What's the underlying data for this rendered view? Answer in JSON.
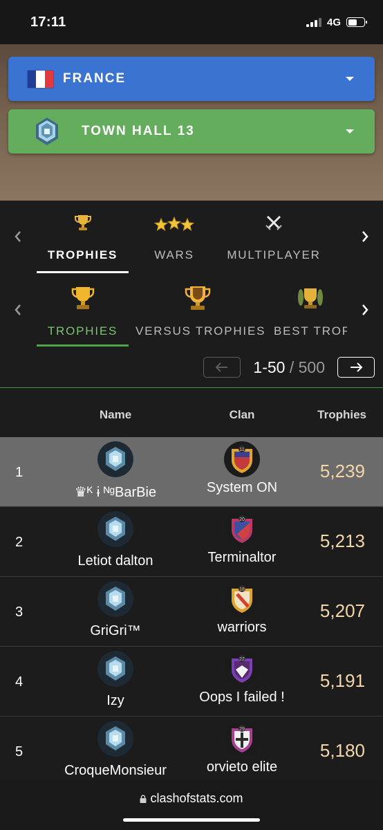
{
  "status_bar": {
    "time": "17:11",
    "network": "4G"
  },
  "filters": {
    "country": {
      "label": "FRANCE"
    },
    "town_hall": {
      "label": "TOWN HALL 13"
    }
  },
  "main_tabs": [
    {
      "label": "TROPHIES",
      "icon": "trophy-icon",
      "active": true
    },
    {
      "label": "WARS",
      "icon": "stars-icon",
      "active": false
    },
    {
      "label": "MULTIPLAYER",
      "icon": "crossed-swords-icon",
      "active": false
    }
  ],
  "sub_tabs": [
    {
      "label": "TROPHIES",
      "icon": "gold-trophy-icon",
      "active": true
    },
    {
      "label": "VERSUS TROPHIES",
      "icon": "versus-trophy-icon",
      "active": false
    },
    {
      "label": "BEST TROP",
      "icon": "laurel-trophy-icon",
      "active": false
    }
  ],
  "pager": {
    "range": "1-50",
    "separator": " / ",
    "total": "500"
  },
  "table": {
    "headers": {
      "name": "Name",
      "clan": "Clan",
      "trophies": "Trophies"
    },
    "rows": [
      {
        "rank": "1",
        "name": "♛ᴷ ɨ ᴺᵍBarBie",
        "clan": "System ON",
        "clan_level": "11",
        "trophies": "5,239"
      },
      {
        "rank": "2",
        "name": "Letiot dalton",
        "clan": "Terminaltor",
        "clan_level": "20",
        "trophies": "5,213"
      },
      {
        "rank": "3",
        "name": "GriGri™",
        "clan": "warriors",
        "clan_level": "18",
        "trophies": "5,207"
      },
      {
        "rank": "4",
        "name": "Izy",
        "clan": "Oops I failed !",
        "clan_level": "22",
        "trophies": "5,191"
      },
      {
        "rank": "5",
        "name": "CroqueMonsieur",
        "clan": "orvieto elite",
        "clan_level": "29",
        "trophies": "5,180"
      }
    ]
  },
  "browser": {
    "url": "clashofstats.com"
  },
  "colors": {
    "country_select": "#3b73d3",
    "townhall_select": "#64ad5c",
    "active_tab_underline_main": "#ffffff",
    "active_tab_sub": "#7cc46f",
    "trophy_value": "#f3d7a9"
  }
}
